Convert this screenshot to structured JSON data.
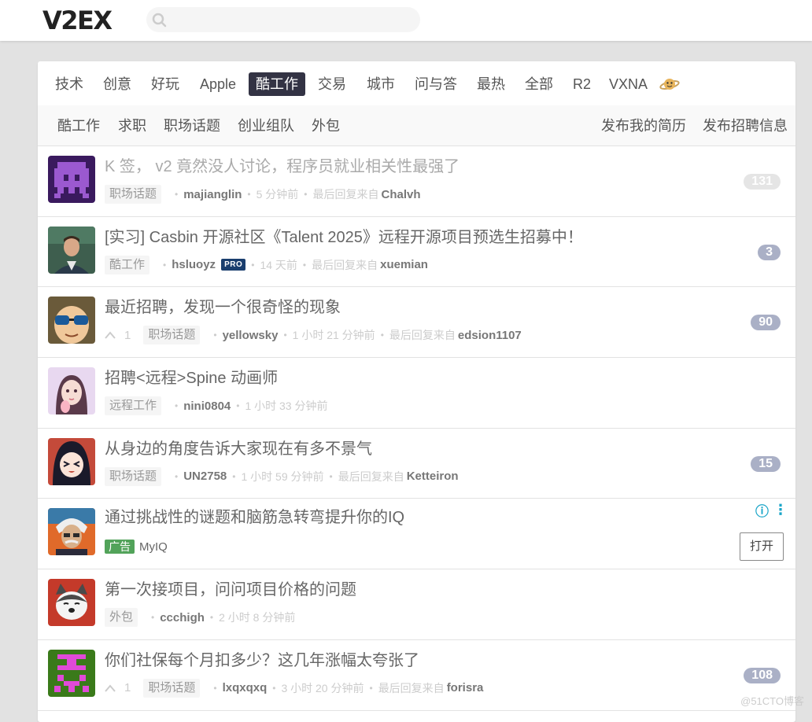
{
  "header": {
    "logo": "V2EX",
    "search_placeholder": ""
  },
  "tabs": [
    {
      "label": "技术"
    },
    {
      "label": "创意"
    },
    {
      "label": "好玩"
    },
    {
      "label": "Apple"
    },
    {
      "label": "酷工作",
      "current": true
    },
    {
      "label": "交易"
    },
    {
      "label": "城市"
    },
    {
      "label": "问与答"
    },
    {
      "label": "最热"
    },
    {
      "label": "全部"
    },
    {
      "label": "R2"
    },
    {
      "label": "VXNA"
    }
  ],
  "subtabs": {
    "left": [
      "酷工作",
      "求职",
      "职场话题",
      "创业组队",
      "外包"
    ],
    "right": [
      "发布我的简历",
      "发布招聘信息"
    ]
  },
  "topics": [
    {
      "title": "K 签， v2 竟然没人讨论，程序员就业相关性最强了",
      "node": "职场话题",
      "author": "majianglin",
      "time": "5 分钟前",
      "last_reply_prefix": "最后回复来自",
      "last_reply_by": "Chalvh",
      "replies": "131",
      "read": true,
      "avatar": "purple-pixel"
    },
    {
      "title": "[实习] Casbin 开源社区《Talent 2025》远程开源项目预选生招募中！",
      "node": "酷工作",
      "author": "hsluoyz",
      "pro_badge": "PRO",
      "time": "14 天前",
      "last_reply_prefix": "最后回复来自",
      "last_reply_by": "xuemian",
      "replies": "3",
      "avatar": "man-photo"
    },
    {
      "title": "最近招聘，发现一个很奇怪的现象",
      "votes": "1",
      "node": "职场话题",
      "author": "yellowsky",
      "time": "1 小时 21 分钟前",
      "last_reply_prefix": "最后回复来自",
      "last_reply_by": "edsion1107",
      "replies": "90",
      "avatar": "cartoon-sunglasses"
    },
    {
      "title": "招聘<远程>Spine 动画师",
      "node": "远程工作",
      "author": "nini0804",
      "time": "1 小时 33 分钟前",
      "avatar": "anime-girl"
    },
    {
      "title": "从身边的角度告诉大家现在有多不景气",
      "node": "职场话题",
      "author": "UN2758",
      "time": "1 小时 59 分钟前",
      "last_reply_prefix": "最后回复来自",
      "last_reply_by": "Ketteiron",
      "replies": "15",
      "avatar": "anime-face"
    }
  ],
  "ad": {
    "title": "通过挑战性的谜题和脑筋急转弯提升你的IQ",
    "tag": "广告",
    "brand": "MyIQ",
    "button": "打开",
    "info_icon": "ⓘ",
    "menu_icon": "⋮"
  },
  "topics_after_ad": [
    {
      "title": "第一次接项目，问问项目价格的问题",
      "node": "外包",
      "author": "ccchigh",
      "time": "2 小时 8 分钟前",
      "avatar": "husky-dog"
    },
    {
      "title": "你们社保每个月扣多少？这几年涨幅太夸张了",
      "votes": "1",
      "node": "职场话题",
      "author": "lxqxqxq",
      "time": "3 小时 20 分钟前",
      "last_reply_prefix": "最后回复来自",
      "last_reply_by": "forisra",
      "replies": "108",
      "avatar": "green-pixel"
    }
  ],
  "watermark": "@51CTO博客",
  "colors": {
    "accent_tab": "#333344",
    "reply_count": "#aab0c6",
    "ad_tag": "#52a35a",
    "page_bg": "#e2e2e2"
  }
}
